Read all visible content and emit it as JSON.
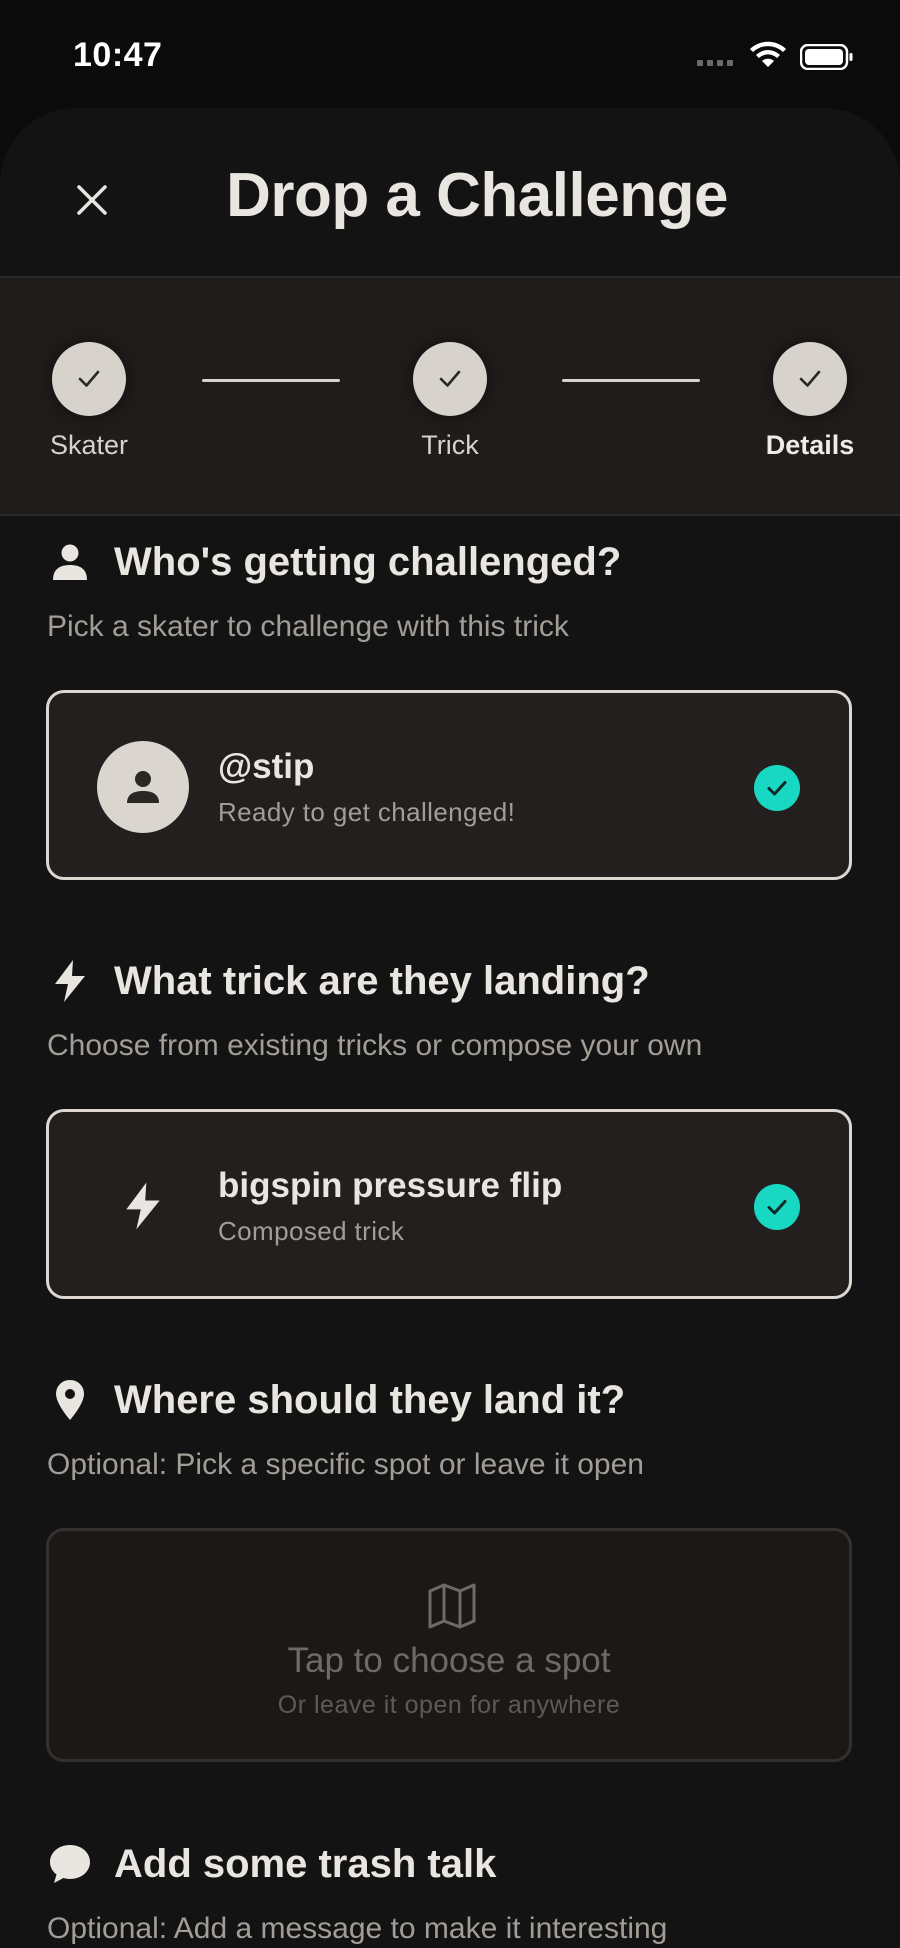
{
  "status_bar": {
    "time": "10:47"
  },
  "header": {
    "title": "Drop a Challenge"
  },
  "stepper": {
    "steps": [
      {
        "label": "Skater",
        "completed": true,
        "current": false
      },
      {
        "label": "Trick",
        "completed": true,
        "current": false
      },
      {
        "label": "Details",
        "completed": true,
        "current": true
      }
    ]
  },
  "skater_section": {
    "title": "Who's getting challenged?",
    "subtitle": "Pick a skater to challenge with this trick",
    "selected": {
      "name": "@stip",
      "status": "Ready to get challenged!"
    }
  },
  "trick_section": {
    "title": "What trick are they landing?",
    "subtitle": "Choose from existing tricks or compose your own",
    "selected": {
      "name": "bigspin pressure flip",
      "type": "Composed trick"
    }
  },
  "spot_section": {
    "title": "Where should they land it?",
    "subtitle": "Optional: Pick a specific spot or leave it open",
    "placeholder_title": "Tap to choose a spot",
    "placeholder_sub": "Or leave it open for anywhere"
  },
  "message_section": {
    "title": "Add some trash talk",
    "subtitle": "Optional: Add a message to make it interesting"
  },
  "colors": {
    "accent": "#19d8c3",
    "background": "#0b0b0b",
    "card_border": "#dcd7d0"
  },
  "icons": {
    "close": "close-icon",
    "step_check": "check-icon",
    "person": "person-icon",
    "bolt": "bolt-icon",
    "pin": "map-pin-icon",
    "map": "map-icon",
    "chat": "chat-bubble-icon"
  }
}
